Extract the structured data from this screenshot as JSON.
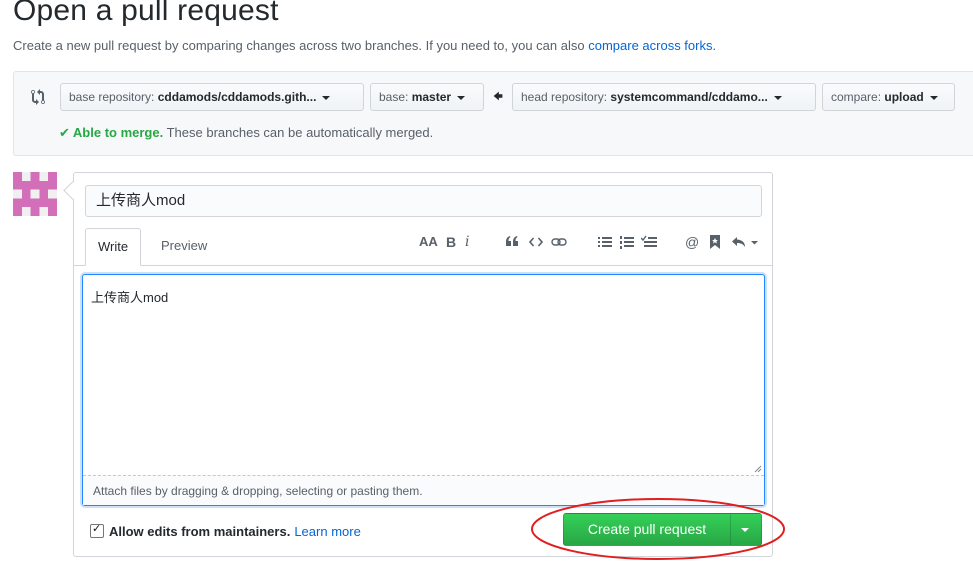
{
  "page": {
    "title": "Open a pull request",
    "subtitle": "Create a new pull request by comparing changes across two branches. If you need to, you can also ",
    "subtitle_link": "compare across forks."
  },
  "range": {
    "base_repo_label": "base repository:",
    "base_repo_value": "cddamods/cddamods.gith...",
    "base_label": "base:",
    "base_value": "master",
    "head_repo_label": "head repository:",
    "head_repo_value": "systemcommand/cddamo...",
    "compare_label": "compare:",
    "compare_value": "upload",
    "merge_ok": "Able to merge.",
    "merge_text": "These branches can be automatically merged."
  },
  "form": {
    "title_value": "上传商人mod",
    "tabs": [
      "Write",
      "Preview"
    ],
    "body_value": "上传商人mod",
    "attach_hint": "Attach files by dragging & dropping, selecting or pasting them.",
    "toolbar": {
      "header": "AA",
      "bold": "B",
      "italic": "i"
    },
    "allow_edits_label": "Allow edits from maintainers.",
    "allow_edits_checked": true,
    "learn_more": "Learn more",
    "submit_label": "Create pull request"
  },
  "colors": {
    "accent": "#0366d6",
    "success": "#28a745",
    "highlight_ring": "#e02020",
    "avatar": "#d26fb8"
  }
}
